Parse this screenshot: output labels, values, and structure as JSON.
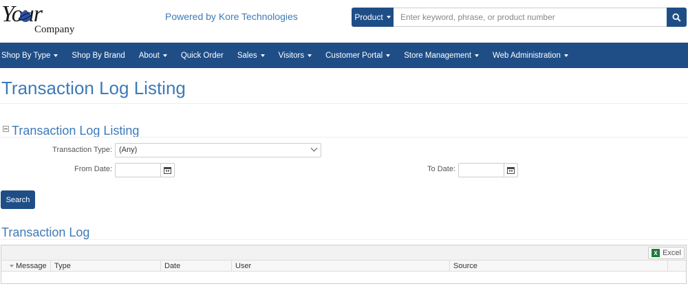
{
  "brand": {
    "logo_word": "Your",
    "logo_sub": "Company",
    "powered_by": "Powered by Kore Technologies"
  },
  "search": {
    "scope_label": "Product",
    "placeholder": "Enter keyword, phrase, or product number",
    "icon": "search-icon"
  },
  "nav": {
    "items": [
      {
        "label": "Shop By Type",
        "dropdown": true
      },
      {
        "label": "Shop By Brand",
        "dropdown": false
      },
      {
        "label": "About",
        "dropdown": true
      },
      {
        "label": "Quick Order",
        "dropdown": false
      },
      {
        "label": "Sales",
        "dropdown": true
      },
      {
        "label": "Visitors",
        "dropdown": true
      },
      {
        "label": "Customer Portal",
        "dropdown": true
      },
      {
        "label": "Store Management",
        "dropdown": true
      },
      {
        "label": "Web Administration",
        "dropdown": true
      }
    ]
  },
  "page": {
    "title": "Transaction Log Listing"
  },
  "filter": {
    "section_title": "Transaction Log Listing",
    "type_label": "Transaction Type:",
    "type_value": "(Any)",
    "from_label": "From Date:",
    "from_value": "",
    "to_label": "To Date:",
    "to_value": "",
    "search_label": "Search"
  },
  "log": {
    "title": "Transaction Log",
    "export_label": "Excel",
    "columns": [
      "Message",
      "Type",
      "Date",
      "User",
      "Source"
    ]
  },
  "colors": {
    "primary": "#1f4e87",
    "heading": "#3d7ab8"
  }
}
